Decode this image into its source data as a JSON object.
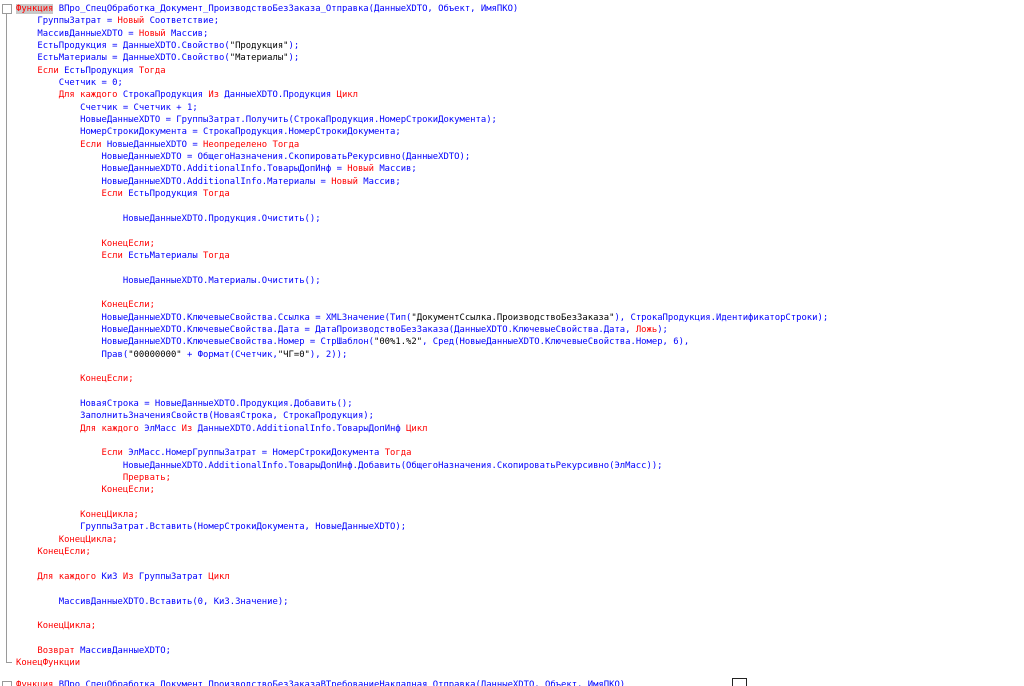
{
  "colors": {
    "keyword": "#ff0000",
    "identifier": "#0000ff",
    "string": "#000000",
    "background": "#ffffff"
  },
  "lines": [
    [
      [
        "k",
        "Функция"
      ],
      [
        "i",
        " ВПро_СпецОбработка_Документ_ПроизводствоБезЗаказа_Отправка(ДанныеXDTO, Объект, ИмяПКО)"
      ]
    ],
    [
      [
        "i",
        "    ГруппыЗатрат = "
      ],
      [
        "k",
        "Новый"
      ],
      [
        "i",
        " Соответствие;"
      ]
    ],
    [
      [
        "i",
        "    МассивДанныеXDTO = "
      ],
      [
        "k",
        "Новый"
      ],
      [
        "i",
        " Массив;"
      ]
    ],
    [
      [
        "i",
        "    ЕстьПродукция = ДанныеXDTO.Свойство("
      ],
      [
        "s",
        "\"Продукция\""
      ],
      [
        "i",
        ");"
      ]
    ],
    [
      [
        "i",
        "    ЕстьМатериалы = ДанныеXDTO.Свойство("
      ],
      [
        "s",
        "\"Материалы\""
      ],
      [
        "i",
        ");"
      ]
    ],
    [
      [
        "k",
        "    Если"
      ],
      [
        "i",
        " ЕстьПродукция "
      ],
      [
        "k",
        "Тогда"
      ]
    ],
    [
      [
        "i",
        "        Счетчик = 0;"
      ]
    ],
    [
      [
        "k",
        "        Для каждого"
      ],
      [
        "i",
        " СтрокаПродукция "
      ],
      [
        "k",
        "Из"
      ],
      [
        "i",
        " ДанныеXDTO.Продукция "
      ],
      [
        "k",
        "Цикл"
      ]
    ],
    [
      [
        "i",
        "            Счетчик = Счетчик + 1;"
      ]
    ],
    [
      [
        "i",
        "            НовыеДанныеXDTO = ГруппыЗатрат.Получить(СтрокаПродукция.НомерСтрокиДокумента);"
      ]
    ],
    [
      [
        "i",
        "            НомерСтрокиДокумента = СтрокаПродукция.НомерСтрокиДокумента;"
      ]
    ],
    [
      [
        "k",
        "            Если"
      ],
      [
        "i",
        " НовыеДанныеXDTO = "
      ],
      [
        "k",
        "Неопределено Тогда"
      ]
    ],
    [
      [
        "i",
        "                НовыеДанныеXDTO = ОбщегоНазначения.СкопироватьРекурсивно(ДанныеXDTO);"
      ]
    ],
    [
      [
        "i",
        "                НовыеДанныеXDTO.AdditionalInfo.ТоварыДопИнф = "
      ],
      [
        "k",
        "Новый"
      ],
      [
        "i",
        " Массив;"
      ]
    ],
    [
      [
        "i",
        "                НовыеДанныеXDTO.AdditionalInfo.Материалы = "
      ],
      [
        "k",
        "Новый"
      ],
      [
        "i",
        " Массив;"
      ]
    ],
    [
      [
        "k",
        "                Если"
      ],
      [
        "i",
        " ЕстьПродукция "
      ],
      [
        "k",
        "Тогда"
      ]
    ],
    [
      [
        "i",
        ""
      ]
    ],
    [
      [
        "i",
        "                    НовыеДанныеXDTO.Продукция.Очистить();"
      ]
    ],
    [
      [
        "i",
        ""
      ]
    ],
    [
      [
        "k",
        "                КонецЕсли;"
      ]
    ],
    [
      [
        "k",
        "                Если"
      ],
      [
        "i",
        " ЕстьМатериалы "
      ],
      [
        "k",
        "Тогда"
      ]
    ],
    [
      [
        "i",
        ""
      ]
    ],
    [
      [
        "i",
        "                    НовыеДанныеXDTO.Материалы.Очистить();"
      ]
    ],
    [
      [
        "i",
        ""
      ]
    ],
    [
      [
        "k",
        "                КонецЕсли;"
      ]
    ],
    [
      [
        "i",
        "                НовыеДанныеXDTO.КлючевыеСвойства.Ссылка = XMLЗначение(Тип("
      ],
      [
        "s",
        "\"ДокументСсылка.ПроизводствоБезЗаказа\""
      ],
      [
        "i",
        "), СтрокаПродукция.ИдентификаторСтроки);"
      ]
    ],
    [
      [
        "i",
        "                НовыеДанныеXDTO.КлючевыеСвойства.Дата = ДатаПроизводствоБезЗаказа(ДанныеXDTO.КлючевыеСвойства.Дата, "
      ],
      [
        "k",
        "Ложь"
      ],
      [
        "i",
        ");"
      ]
    ],
    [
      [
        "i",
        "                НовыеДанныеXDTO.КлючевыеСвойства.Номер = СтрШаблон("
      ],
      [
        "s",
        "\"00%1.%2\""
      ],
      [
        "i",
        ", Сред(НовыеДанныеXDTO.КлючевыеСвойства.Номер, 6),"
      ]
    ],
    [
      [
        "i",
        "                Прав("
      ],
      [
        "s",
        "\"00000000\""
      ],
      [
        "i",
        " + Формат(Счетчик,"
      ],
      [
        "s",
        "\"ЧГ=0\""
      ],
      [
        "i",
        "), 2));"
      ]
    ],
    [
      [
        "i",
        ""
      ]
    ],
    [
      [
        "k",
        "            КонецЕсли;"
      ]
    ],
    [
      [
        "i",
        ""
      ]
    ],
    [
      [
        "i",
        "            НоваяСтрока = НовыеДанныеXDTO.Продукция.Добавить();"
      ]
    ],
    [
      [
        "i",
        "            ЗаполнитьЗначенияСвойств(НоваяСтрока, СтрокаПродукция);"
      ]
    ],
    [
      [
        "k",
        "            Для каждого"
      ],
      [
        "i",
        " ЭлМасс "
      ],
      [
        "k",
        "Из"
      ],
      [
        "i",
        " ДанныеXDTO.AdditionalInfo.ТоварыДопИнф "
      ],
      [
        "k",
        "Цикл"
      ]
    ],
    [
      [
        "i",
        ""
      ]
    ],
    [
      [
        "k",
        "                Если"
      ],
      [
        "i",
        " ЭлМасс.НомерГруппыЗатрат = НомерСтрокиДокумента "
      ],
      [
        "k",
        "Тогда"
      ]
    ],
    [
      [
        "i",
        "                    НовыеДанныеXDTO.AdditionalInfo.ТоварыДопИнф.Добавить(ОбщегоНазначения.СкопироватьРекурсивно(ЭлМасс));"
      ]
    ],
    [
      [
        "k",
        "                    Прервать;"
      ]
    ],
    [
      [
        "k",
        "                КонецЕсли;"
      ]
    ],
    [
      [
        "i",
        ""
      ]
    ],
    [
      [
        "k",
        "            КонецЦикла;"
      ]
    ],
    [
      [
        "i",
        "            ГруппыЗатрат.Вставить(НомерСтрокиДокумента, НовыеДанныеXDTO);"
      ]
    ],
    [
      [
        "k",
        "        КонецЦикла;"
      ]
    ],
    [
      [
        "k",
        "    КонецЕсли;"
      ]
    ],
    [
      [
        "i",
        ""
      ]
    ],
    [
      [
        "k",
        "    Для каждого"
      ],
      [
        "i",
        " КиЗ "
      ],
      [
        "k",
        "Из"
      ],
      [
        "i",
        " ГруппыЗатрат "
      ],
      [
        "k",
        "Цикл"
      ]
    ],
    [
      [
        "i",
        ""
      ]
    ],
    [
      [
        "i",
        "        МассивДанныеXDTO.Вставить(0, КиЗ.Значение);"
      ]
    ],
    [
      [
        "i",
        ""
      ]
    ],
    [
      [
        "k",
        "    КонецЦикла;"
      ]
    ],
    [
      [
        "i",
        ""
      ]
    ],
    [
      [
        "k",
        "    Возврат"
      ],
      [
        "i",
        " МассивДанныеXDTO;"
      ]
    ],
    [
      [
        "k",
        "КонецФункции"
      ]
    ]
  ],
  "next_line": [
    [
      "k",
      "Функция"
    ],
    [
      "i",
      " ВПро_СпецОбработка_Документ_ПроизводствоБезЗаказаВТребованиеНакладная_Отправка(ДанныеXDTO, Объект, ИмяПКО)"
    ]
  ]
}
